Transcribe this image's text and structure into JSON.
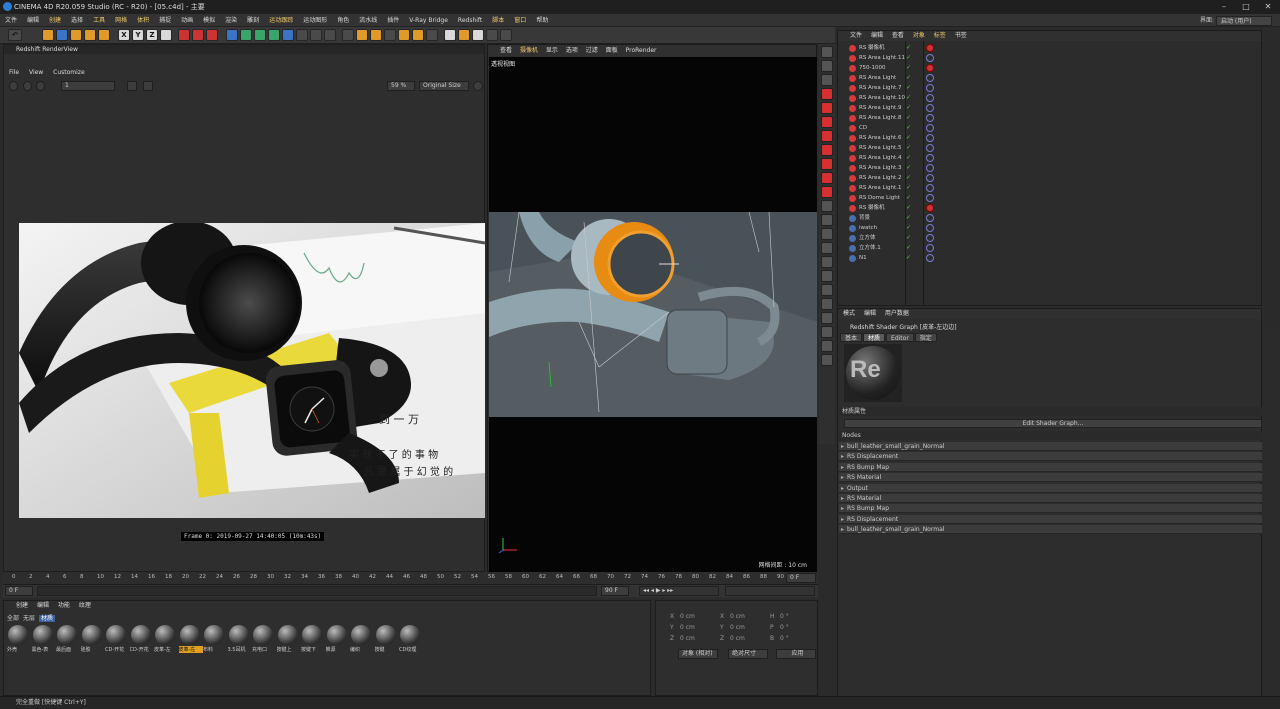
{
  "app": {
    "title": "CINEMA 4D R20.059 Studio (RC - R20) - [05.c4d] - 主要",
    "interface_label": "界面:",
    "interface_value": "启动 (用户)"
  },
  "menubar": [
    "文件",
    "编辑",
    "创建",
    "选择",
    "工具",
    "网格",
    "体积",
    "捕捉",
    "动画",
    "模拟",
    "渲染",
    "雕刻",
    "运动跟踪",
    "运动图形",
    "角色",
    "流水线",
    "插件",
    "V-Ray Bridge",
    "Redshift",
    "脚本",
    "窗口",
    "帮助"
  ],
  "rsview": {
    "title": "Redshift RenderView",
    "menu": [
      "File",
      "View",
      "Customize"
    ],
    "frame_field": "1",
    "zoom": "59 %",
    "size": "Original Size",
    "frame_label": "Frame  0:  2019-09-27  14:40:05  (10m:43s)"
  },
  "viewport": {
    "menu": [
      "查看",
      "摄像机",
      "显示",
      "选项",
      "过滤",
      "面板",
      "ProRender"
    ],
    "label": "透视视图",
    "grid": "网格间距 : 10 cm"
  },
  "objmgr": {
    "menu": [
      "文件",
      "编辑",
      "查看",
      "对象",
      "标签",
      "书签"
    ],
    "objects": [
      "RS 摄像机",
      "RS Area Light.11",
      "750-1000",
      "RS Area Light",
      "RS Area Light.7",
      "RS Area Light.10",
      "RS Area Light.9",
      "RS Area Light.8",
      "CD",
      "RS Area Light.6",
      "RS Area Light.5",
      "RS Area Light.4",
      "RS Area Light.3",
      "RS Area Light.2",
      "RS Area Light.1",
      "RS Dome Light",
      "RS 摄像机",
      "背景",
      "iwatch",
      "立方体",
      "立方体.1",
      "N1"
    ]
  },
  "attr": {
    "menu": [
      "模式",
      "编辑",
      "用户数据"
    ],
    "title": "Redshift Shader Graph [皮革-左边边]",
    "tabs": [
      "基本",
      "材质",
      "Editor",
      "指定"
    ],
    "section": "材质属性",
    "edit_button": "Edit Shader Graph...",
    "nodes_label": "Nodes",
    "nodes": [
      "bull_leather_small_grain_Normal",
      "RS Displacement",
      "RS Bump Map",
      "RS Material",
      "Output",
      "RS Material",
      "RS Bump Map",
      "RS Displacement",
      "bull_leather_small_grain_Normal"
    ]
  },
  "timeline": {
    "ticks": [
      "0",
      "2",
      "4",
      "6",
      "8",
      "10",
      "12",
      "14",
      "16",
      "18",
      "20",
      "22",
      "24",
      "26",
      "28",
      "30",
      "32",
      "34",
      "36",
      "38",
      "40",
      "42",
      "44",
      "46",
      "48",
      "50",
      "52",
      "54",
      "56",
      "58",
      "60",
      "62",
      "64",
      "66",
      "68",
      "70",
      "72",
      "74",
      "76",
      "78",
      "80",
      "82",
      "84",
      "86",
      "88",
      "90"
    ],
    "start": "0 F",
    "end": "90 F",
    "cur": "0 F",
    "end2": "90 F"
  },
  "matmgr": {
    "menu": [
      "创建",
      "编辑",
      "功能",
      "纹理"
    ],
    "filters": [
      "全部",
      "无层",
      "材质"
    ],
    "materials": [
      "外壳",
      "黑色-表",
      "最后面",
      "硅胶",
      "CD-开花",
      "CD-开花",
      "皮革-左",
      "皮革-左",
      "布料",
      "3.5耳机",
      "充电口",
      "按键上",
      "按键下",
      "推源",
      "编织",
      "按键",
      "CD纹理"
    ]
  },
  "coords": {
    "rows": [
      [
        "X",
        "0 cm",
        "X",
        "0 cm",
        "H",
        "0 °"
      ],
      [
        "Y",
        "0 cm",
        "Y",
        "0 cm",
        "P",
        "0 °"
      ],
      [
        "Z",
        "0 cm",
        "Z",
        "0 cm",
        "B",
        "0 °"
      ]
    ],
    "mode": "对象 (相对)",
    "size": "绝对尺寸",
    "apply": "应用"
  },
  "status": "完全重做 [快捷键 Ctrl+Y]"
}
